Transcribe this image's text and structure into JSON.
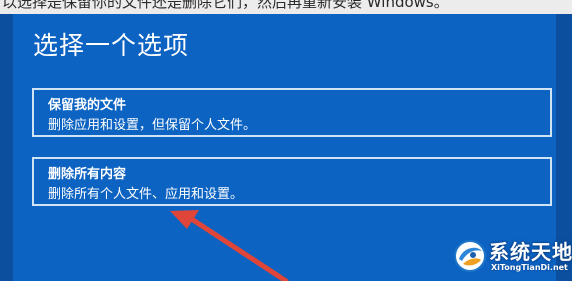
{
  "background": {
    "text": "以选择是保留你的文件还是删除它们，然后再重新安装 Windows。"
  },
  "dialog": {
    "title": "选择一个选项",
    "options": [
      {
        "title": "保留我的文件",
        "description": "删除应用和设置，但保留个人文件。"
      },
      {
        "title": "删除所有内容",
        "description": "删除所有个人文件、应用和设置。"
      }
    ]
  },
  "watermark": {
    "name": "系统天地",
    "url": "XiTongTianDi.net"
  },
  "colors": {
    "dialog_bg": "#0d63c2",
    "option_border": "#cfe2f6",
    "annotation_arrow": "#e0453a"
  },
  "icons": [
    "annotation-arrow",
    "watermark-logo-icon"
  ]
}
